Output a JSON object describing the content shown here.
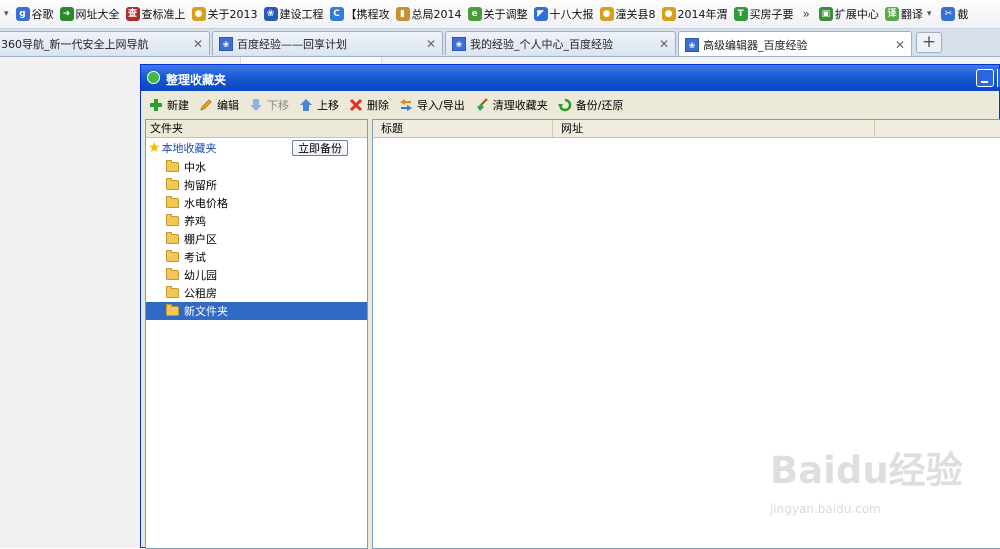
{
  "bookmarks_bar": {
    "items": [
      {
        "label": "谷歌",
        "icon": "google-icon",
        "color": "#3b6fd8",
        "glyph": "g"
      },
      {
        "label": "网址大全",
        "icon": "hao123-icon",
        "color": "#2a8a2a",
        "glyph": "➜"
      },
      {
        "label": "查标准上",
        "icon": "standard-icon",
        "color": "#b02a2a",
        "glyph": "查"
      },
      {
        "label": "关于2013",
        "icon": "emblem-icon",
        "color": "#d8a018",
        "glyph": "●"
      },
      {
        "label": "建设工程",
        "icon": "paw-icon",
        "color": "#2c58b8",
        "glyph": "❀"
      },
      {
        "label": "【携程攻",
        "icon": "ctrip-icon",
        "color": "#2f7ed8",
        "glyph": "C"
      },
      {
        "label": "总局2014",
        "icon": "chart-icon",
        "color": "#c8902a",
        "glyph": "▮"
      },
      {
        "label": "关于调整",
        "icon": "page-icon",
        "color": "#4a9c3a",
        "glyph": "e"
      },
      {
        "label": "十八大报",
        "icon": "flag-icon",
        "color": "#2f6fcf",
        "glyph": "◤"
      },
      {
        "label": "潼关县8",
        "icon": "emblem-icon",
        "color": "#d8a018",
        "glyph": "●"
      },
      {
        "label": "2014年渭",
        "icon": "emblem-icon",
        "color": "#d8a018",
        "glyph": "●"
      },
      {
        "label": "买房子要",
        "icon": "t-icon",
        "color": "#2f9c3a",
        "glyph": "T"
      }
    ],
    "more": "»",
    "extensions_label": "扩展中心",
    "translate_label": "翻译",
    "last_label": "截"
  },
  "tabs": [
    {
      "title": "360导航_新一代安全上网导航",
      "active": false
    },
    {
      "title": "百度经验——回享计划",
      "active": false
    },
    {
      "title": "我的经验_个人中心_百度经验",
      "active": false
    },
    {
      "title": "高级编辑器_百度经验",
      "active": true
    }
  ],
  "new_tab": "+",
  "close_glyph": "✕",
  "dialog": {
    "title": "整理收藏夹",
    "toolbar": [
      {
        "label": "新建",
        "icon": "plus-icon",
        "disabled": false
      },
      {
        "label": "编辑",
        "icon": "pencil-icon",
        "disabled": false
      },
      {
        "label": "下移",
        "icon": "arrow-down-icon",
        "disabled": true
      },
      {
        "label": "上移",
        "icon": "arrow-up-icon",
        "disabled": false
      },
      {
        "label": "删除",
        "icon": "delete-x-icon",
        "disabled": false
      },
      {
        "label": "导入/导出",
        "icon": "import-export-icon",
        "disabled": false
      },
      {
        "label": "清理收藏夹",
        "icon": "broom-icon",
        "disabled": false
      },
      {
        "label": "备份/还原",
        "icon": "restore-icon",
        "disabled": false
      }
    ],
    "folder_panel": {
      "header": "文件夹",
      "root_label": "本地收藏夹",
      "backup_button": "立即备份",
      "folders": [
        "中水",
        "拘留所",
        "水电价格",
        "养鸡",
        "棚户区",
        "考试",
        "幼儿园",
        "公租房",
        "新文件夹"
      ],
      "selected_index": 8
    },
    "list_panel": {
      "columns": [
        "标题",
        "网址"
      ]
    }
  },
  "watermark": {
    "logo": "Baidu经验",
    "url": "jingyan.baidu.com"
  }
}
